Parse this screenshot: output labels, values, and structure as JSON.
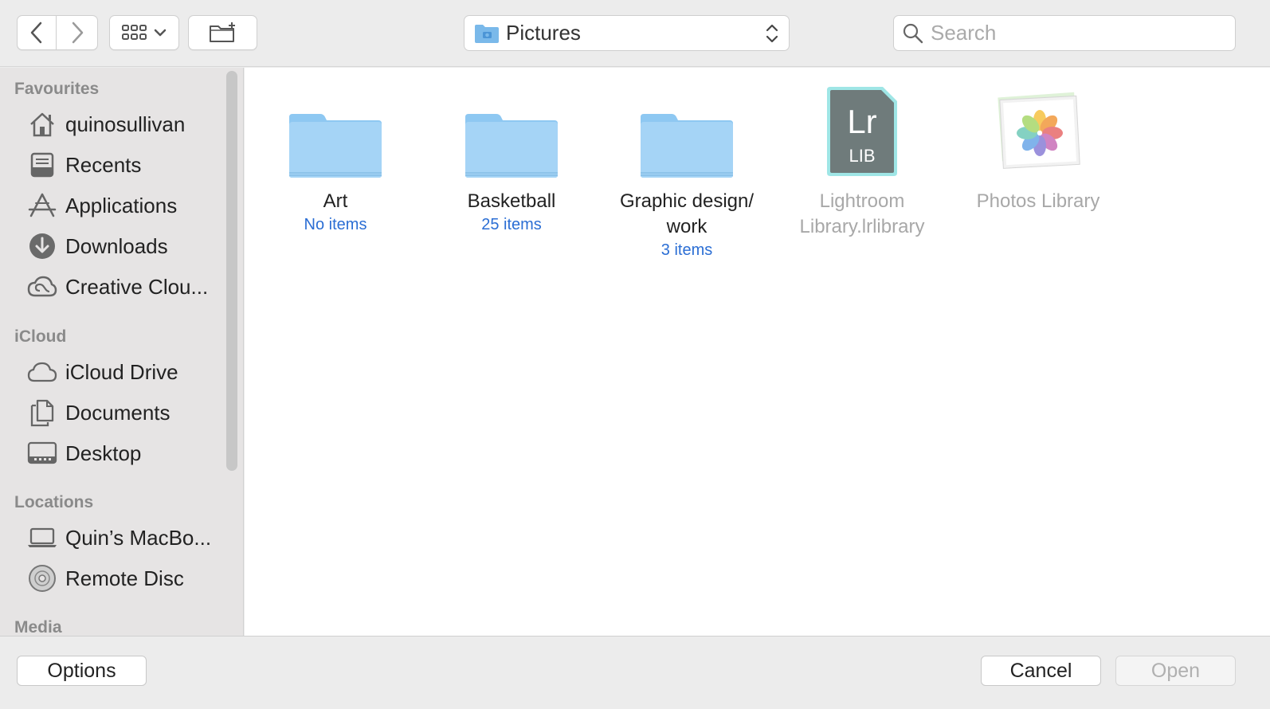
{
  "toolbar": {
    "path_label": "Pictures",
    "search_placeholder": "Search"
  },
  "sidebar": {
    "sections": [
      {
        "title": "Favourites"
      },
      {
        "title": "iCloud"
      },
      {
        "title": "Locations"
      },
      {
        "title": "Media"
      }
    ],
    "favourites": [
      {
        "label": "quinosullivan",
        "icon": "home-icon"
      },
      {
        "label": "Recents",
        "icon": "recents-icon"
      },
      {
        "label": "Applications",
        "icon": "applications-icon"
      },
      {
        "label": "Downloads",
        "icon": "downloads-icon"
      },
      {
        "label": "Creative Clou...",
        "icon": "creative-cloud-icon"
      }
    ],
    "icloud": [
      {
        "label": "iCloud Drive",
        "icon": "cloud-icon"
      },
      {
        "label": "Documents",
        "icon": "documents-icon"
      },
      {
        "label": "Desktop",
        "icon": "desktop-icon"
      }
    ],
    "locations": [
      {
        "label": "Quin’s MacBo...",
        "icon": "laptop-icon"
      },
      {
        "label": "Remote Disc",
        "icon": "disc-icon"
      }
    ]
  },
  "files": [
    {
      "name": "Art",
      "sub": "No items",
      "type": "folder"
    },
    {
      "name": "Basketball",
      "sub": "25 items",
      "type": "folder"
    },
    {
      "name": "Graphic design/ work",
      "sub": "3 items",
      "type": "folder"
    },
    {
      "name": "Lightroom Library.lrlibrary",
      "sub": "",
      "type": "lightroom",
      "badge_top": "Lr",
      "badge_bottom": "LIB"
    },
    {
      "name": "Photos Library",
      "sub": "",
      "type": "photos"
    }
  ],
  "buttons": {
    "options": "Options",
    "cancel": "Cancel",
    "open": "Open"
  },
  "colors": {
    "accent": "#2b6ed4",
    "folder": "#8ec8f2",
    "lightroom_bg": "#6f7b7b",
    "lightroom_border": "#9fe6e6"
  }
}
